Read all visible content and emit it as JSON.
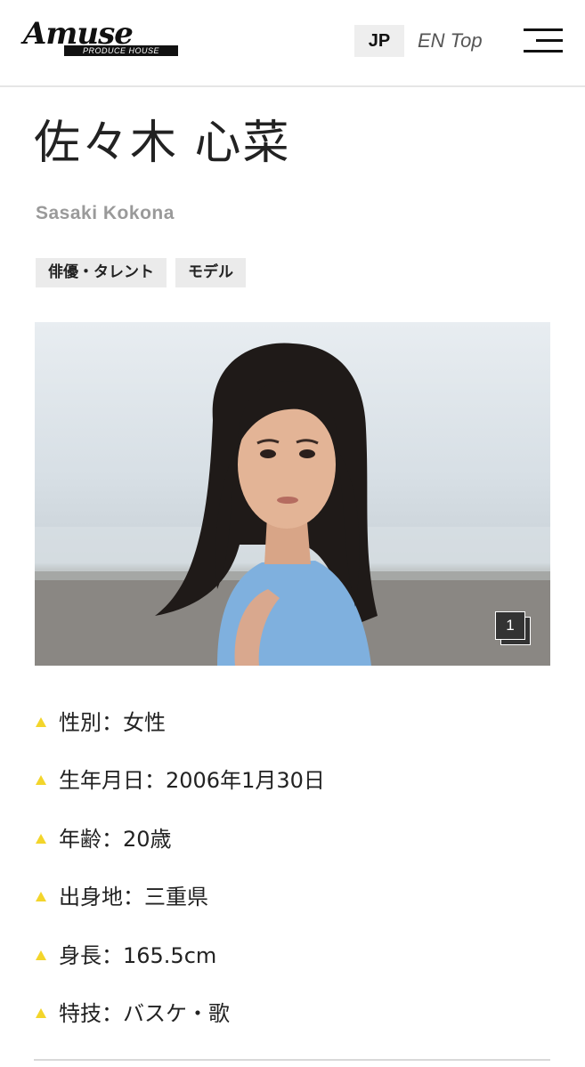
{
  "header": {
    "logo_word": "Amuse",
    "logo_sub": "PRODUCE HOUSE",
    "lang_jp": "JP",
    "lang_en": "EN Top"
  },
  "profile": {
    "name_jp": "佐々木 心菜",
    "name_en": "Sasaki Kokona",
    "tags": [
      "俳優・タレント",
      "モデル"
    ],
    "photo_count": "1",
    "details": [
      "性別：女性",
      "生年月日：2006年1月30日",
      "年齢：20歳",
      "出身地：三重県",
      "身長：165.5cm",
      "特技：バスケ・歌"
    ]
  },
  "colors": {
    "bullet": "#f3d52b",
    "tag_bg": "#ebebeb",
    "subtitle": "#9a9a9a"
  },
  "icons": {
    "menu": "hamburger-menu-icon",
    "bullet": "triangle-bullet-icon",
    "photo_stack": "photo-stack-icon"
  }
}
